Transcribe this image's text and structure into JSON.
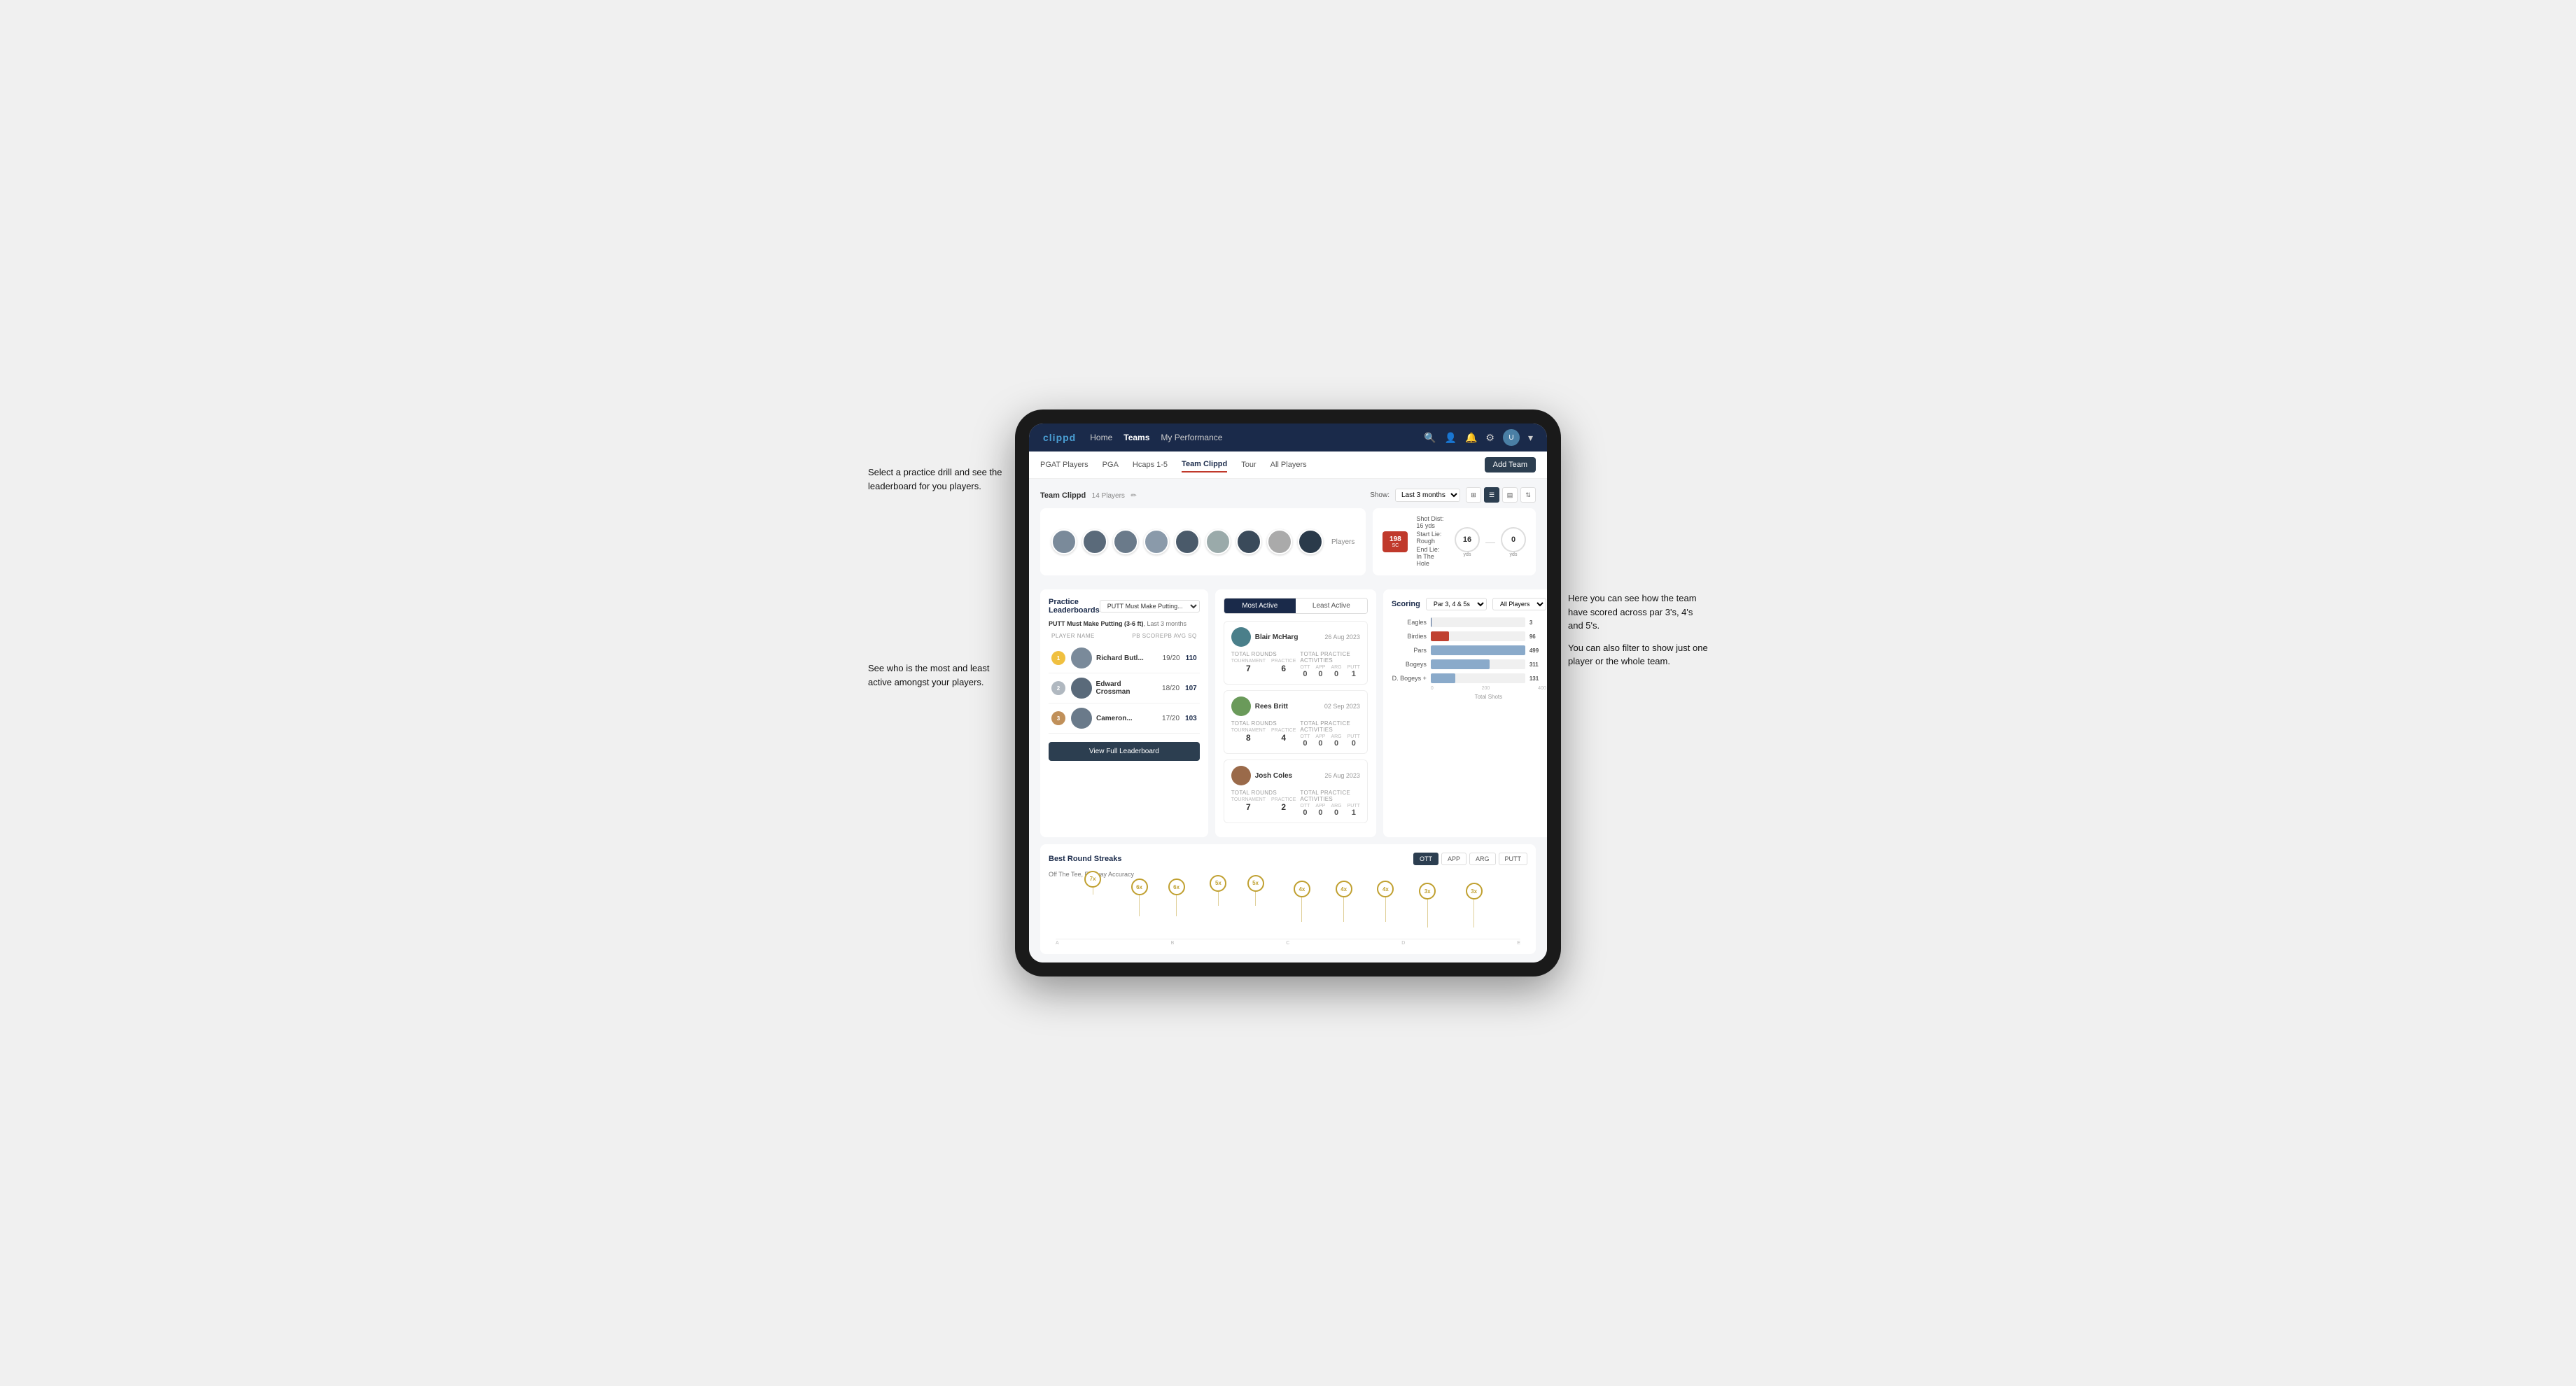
{
  "annotations": {
    "top_left": "Select a practice drill and see the leaderboard for you players.",
    "bottom_left": "See who is the most and least active amongst your players.",
    "right_top": "Here you can see how the team have scored across par 3's, 4's and 5's.",
    "right_bottom": "You can also filter to show just one player or the whole team."
  },
  "nav": {
    "brand": "clippd",
    "links": [
      "Home",
      "Teams",
      "My Performance"
    ],
    "active": "Teams"
  },
  "sub_nav": {
    "links": [
      "PGAT Players",
      "PGA",
      "Hcaps 1-5",
      "Team Clippd",
      "Tour",
      "All Players"
    ],
    "active": "Team Clippd",
    "add_team": "Add Team"
  },
  "team": {
    "name": "Team Clippd",
    "player_count": "14 Players",
    "show_label": "Show:",
    "show_value": "Last 3 months",
    "players_label": "Players"
  },
  "shot_info": {
    "distance_label": "Shot Dist: 16 yds",
    "start_lie_label": "Start Lie: Rough",
    "end_lie_label": "End Lie: In The Hole",
    "red_box_value": "198",
    "red_box_unit": "SC",
    "circle1_value": "16",
    "circle1_label": "yds",
    "circle2_value": "0",
    "circle2_label": "yds"
  },
  "practice_leaderboards": {
    "title": "Practice Leaderboards",
    "drill": "PUTT Must Make Putting...",
    "subtitle_drill": "PUTT Must Make Putting (3-6 ft)",
    "subtitle_period": "Last 3 months",
    "columns": {
      "player_name": "PLAYER NAME",
      "pb_score": "PB SCORE",
      "avg_sq": "PB AVG SQ"
    },
    "players": [
      {
        "rank": 1,
        "rank_type": "gold",
        "name": "Richard Butl...",
        "score": "19/20",
        "avg": "110",
        "avatar_color": "#7a8a9a"
      },
      {
        "rank": 2,
        "rank_type": "silver",
        "name": "Edward Crossman",
        "score": "18/20",
        "avg": "107",
        "avatar_color": "#5a6a7a"
      },
      {
        "rank": 3,
        "rank_type": "bronze",
        "name": "Cameron...",
        "score": "17/20",
        "avg": "103",
        "avatar_color": "#6a7a8a"
      }
    ],
    "view_full_label": "View Full Leaderboard"
  },
  "activity": {
    "tab_most": "Most Active",
    "tab_least": "Least Active",
    "active_tab": "Most Active",
    "players": [
      {
        "name": "Blair McHarg",
        "date": "26 Aug 2023",
        "total_rounds_label": "Total Rounds",
        "tournament": "7",
        "practice": "6",
        "practice_label": "Practice",
        "tournament_label": "Tournament",
        "total_practice_label": "Total Practice Activities",
        "ott": "0",
        "app": "0",
        "arg": "0",
        "putt": "1",
        "avatar_color": "#4a7f8a"
      },
      {
        "name": "Rees Britt",
        "date": "02 Sep 2023",
        "total_rounds_label": "Total Rounds",
        "tournament": "8",
        "practice": "4",
        "practice_label": "Practice",
        "tournament_label": "Tournament",
        "total_practice_label": "Total Practice Activities",
        "ott": "0",
        "app": "0",
        "arg": "0",
        "putt": "0",
        "avatar_color": "#6a9a5a"
      },
      {
        "name": "Josh Coles",
        "date": "26 Aug 2023",
        "total_rounds_label": "Total Rounds",
        "tournament": "7",
        "practice": "2",
        "practice_label": "Practice",
        "tournament_label": "Tournament",
        "total_practice_label": "Total Practice Activities",
        "ott": "0",
        "app": "0",
        "arg": "0",
        "putt": "1",
        "avatar_color": "#9a6a4a"
      }
    ]
  },
  "scoring": {
    "title": "Scoring",
    "filter1": "Par 3, 4 & 5s",
    "filter2": "All Players",
    "bars": [
      {
        "label": "Eagles",
        "value": 3,
        "max": 500,
        "color": "#3a5a8a"
      },
      {
        "label": "Birdies",
        "value": 96,
        "max": 500,
        "color": "#c04030"
      },
      {
        "label": "Pars",
        "value": 499,
        "max": 500,
        "color": "#8aaaca"
      },
      {
        "label": "Bogeys",
        "value": 311,
        "max": 500,
        "color": "#8aaaca"
      },
      {
        "label": "D. Bogeys +",
        "value": 131,
        "max": 500,
        "color": "#8aaaca"
      }
    ],
    "x_labels": [
      "0",
      "200",
      "400"
    ],
    "x_axis_label": "Total Shots"
  },
  "streaks": {
    "title": "Best Round Streaks",
    "subtitle": "Off The Tee, Fairway Accuracy",
    "buttons": [
      "OTT",
      "APP",
      "ARG",
      "PUTT"
    ],
    "active_button": "OTT",
    "points": [
      {
        "x_pct": 8,
        "y_pct": 20,
        "label": "7x"
      },
      {
        "x_pct": 18,
        "y_pct": 60,
        "label": "6x"
      },
      {
        "x_pct": 26,
        "y_pct": 60,
        "label": "6x"
      },
      {
        "x_pct": 35,
        "y_pct": 40,
        "label": "5x"
      },
      {
        "x_pct": 43,
        "y_pct": 40,
        "label": "5x"
      },
      {
        "x_pct": 53,
        "y_pct": 70,
        "label": "4x"
      },
      {
        "x_pct": 62,
        "y_pct": 70,
        "label": "4x"
      },
      {
        "x_pct": 71,
        "y_pct": 70,
        "label": "4x"
      },
      {
        "x_pct": 80,
        "y_pct": 80,
        "label": "3x"
      },
      {
        "x_pct": 90,
        "y_pct": 80,
        "label": "3x"
      }
    ]
  }
}
